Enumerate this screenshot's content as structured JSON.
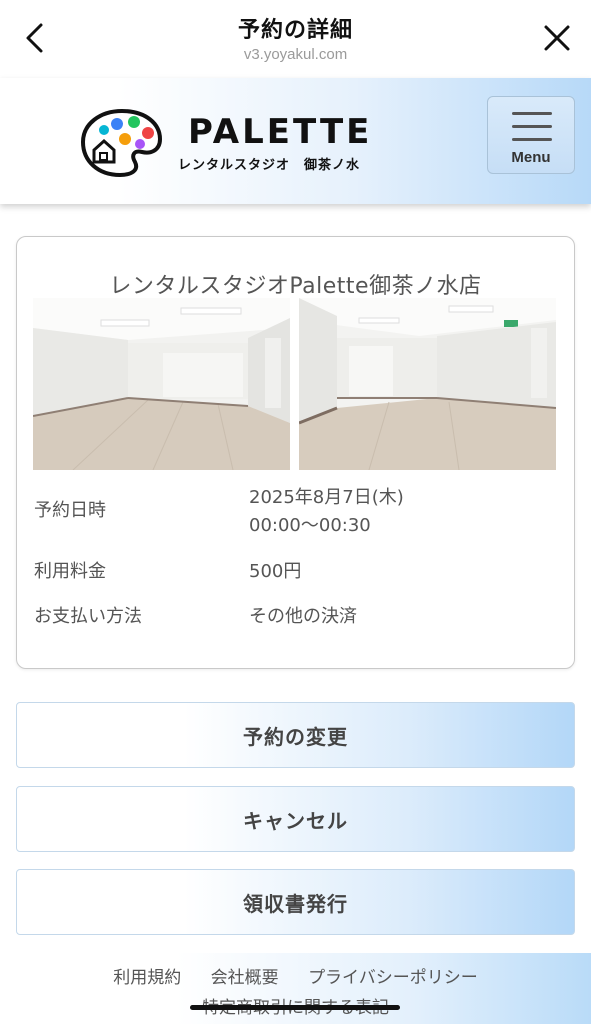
{
  "topbar": {
    "title": "予約の詳細",
    "url": "v3.yoyakul.com",
    "back_icon": "chevron-left-icon",
    "close_icon": "close-icon"
  },
  "header": {
    "brand": "PALETTE",
    "subtitle": "レンタルスタジオ　御茶ノ水",
    "menu_label": "Menu",
    "menu_icon": "hamburger-icon",
    "palette_colors": [
      "#3b82f6",
      "#22c55e",
      "#ef4444",
      "#f59e0b",
      "#a855f7",
      "#06b6d4"
    ]
  },
  "reservation": {
    "studio_name": "レンタルスタジオPalette御茶ノ水店",
    "rows": [
      {
        "label": "予約日時",
        "value_line1": "2025年8月7日(木)",
        "value_line2": "00:00〜00:30"
      },
      {
        "label": "利用料金",
        "value_line1": "500円"
      },
      {
        "label": "お支払い方法",
        "value_line1": "その他の決済"
      }
    ]
  },
  "actions": {
    "change": "予約の変更",
    "cancel": "キャンセル",
    "receipt": "領収書発行"
  },
  "footer": {
    "links": [
      "利用規約",
      "会社概要",
      "プライバシーポリシー"
    ],
    "link_tokushoho": "特定商取引に関する表記"
  }
}
